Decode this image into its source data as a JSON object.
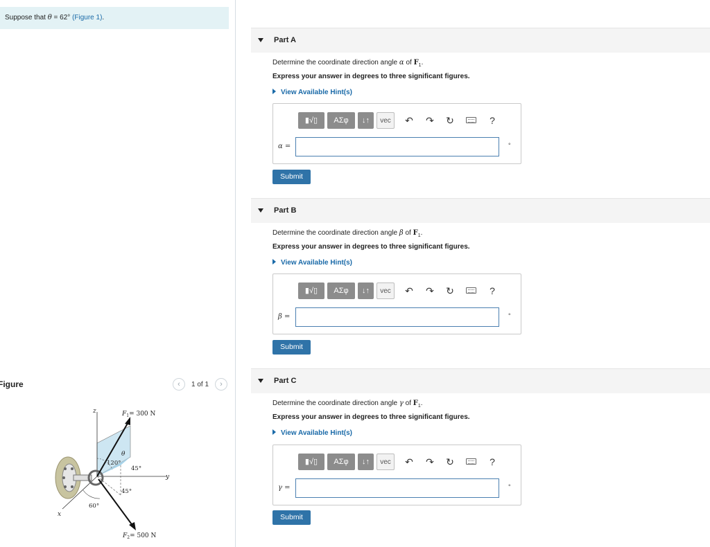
{
  "problem": {
    "prefix": "Suppose that",
    "theta_symbol": "θ",
    "equals_value": "= 62°",
    "figure_link": "(Figure 1)",
    "suffix": "."
  },
  "figure": {
    "title": "Figure",
    "page_count": "1 of 1",
    "prev_icon": "chevron-left-icon",
    "next_icon": "chevron-right-icon",
    "labels": {
      "z": "z",
      "y": "y",
      "x": "x",
      "f1": "F",
      "f1_sub": "1",
      "f1_value": "= 300 N",
      "f2": "F",
      "f2_sub": "2",
      "f2_value": "= 500 N",
      "theta": "θ",
      "angle_120": "120°",
      "angle_45a": "45°",
      "angle_45b": "45°",
      "angle_60": "60°"
    }
  },
  "toolbar": {
    "templates": "▮√▯",
    "greek": "ΑΣφ",
    "arrows": "↓↑",
    "vec": "vec",
    "undo_icon": "undo-icon",
    "redo_icon": "redo-icon",
    "reset_icon": "reset-icon",
    "keyboard_icon": "keyboard-icon",
    "help": "?"
  },
  "parts": [
    {
      "title": "Part A",
      "question_prefix": "Determine the coordinate direction angle",
      "angle_symbol": "α",
      "question_of": "of",
      "force_symbol": "F",
      "force_sub": "1",
      "instruction": "Express your answer in degrees to three significant figures.",
      "hint": "View Available Hint(s)",
      "var_label": "α =",
      "answer_value": "",
      "unit": "°",
      "submit": "Submit"
    },
    {
      "title": "Part B",
      "question_prefix": "Determine the coordinate direction angle",
      "angle_symbol": "β",
      "question_of": "of",
      "force_symbol": "F",
      "force_sub": "1",
      "instruction": "Express your answer in degrees to three significant figures.",
      "hint": "View Available Hint(s)",
      "var_label": "β =",
      "answer_value": "",
      "unit": "°",
      "submit": "Submit"
    },
    {
      "title": "Part C",
      "question_prefix": "Determine the coordinate direction angle",
      "angle_symbol": "γ",
      "question_of": "of",
      "force_symbol": "F",
      "force_sub": "1",
      "instruction": "Express your answer in degrees to three significant figures.",
      "hint": "View Available Hint(s)",
      "var_label": "γ =",
      "answer_value": "",
      "unit": "°",
      "submit": "Submit"
    }
  ]
}
